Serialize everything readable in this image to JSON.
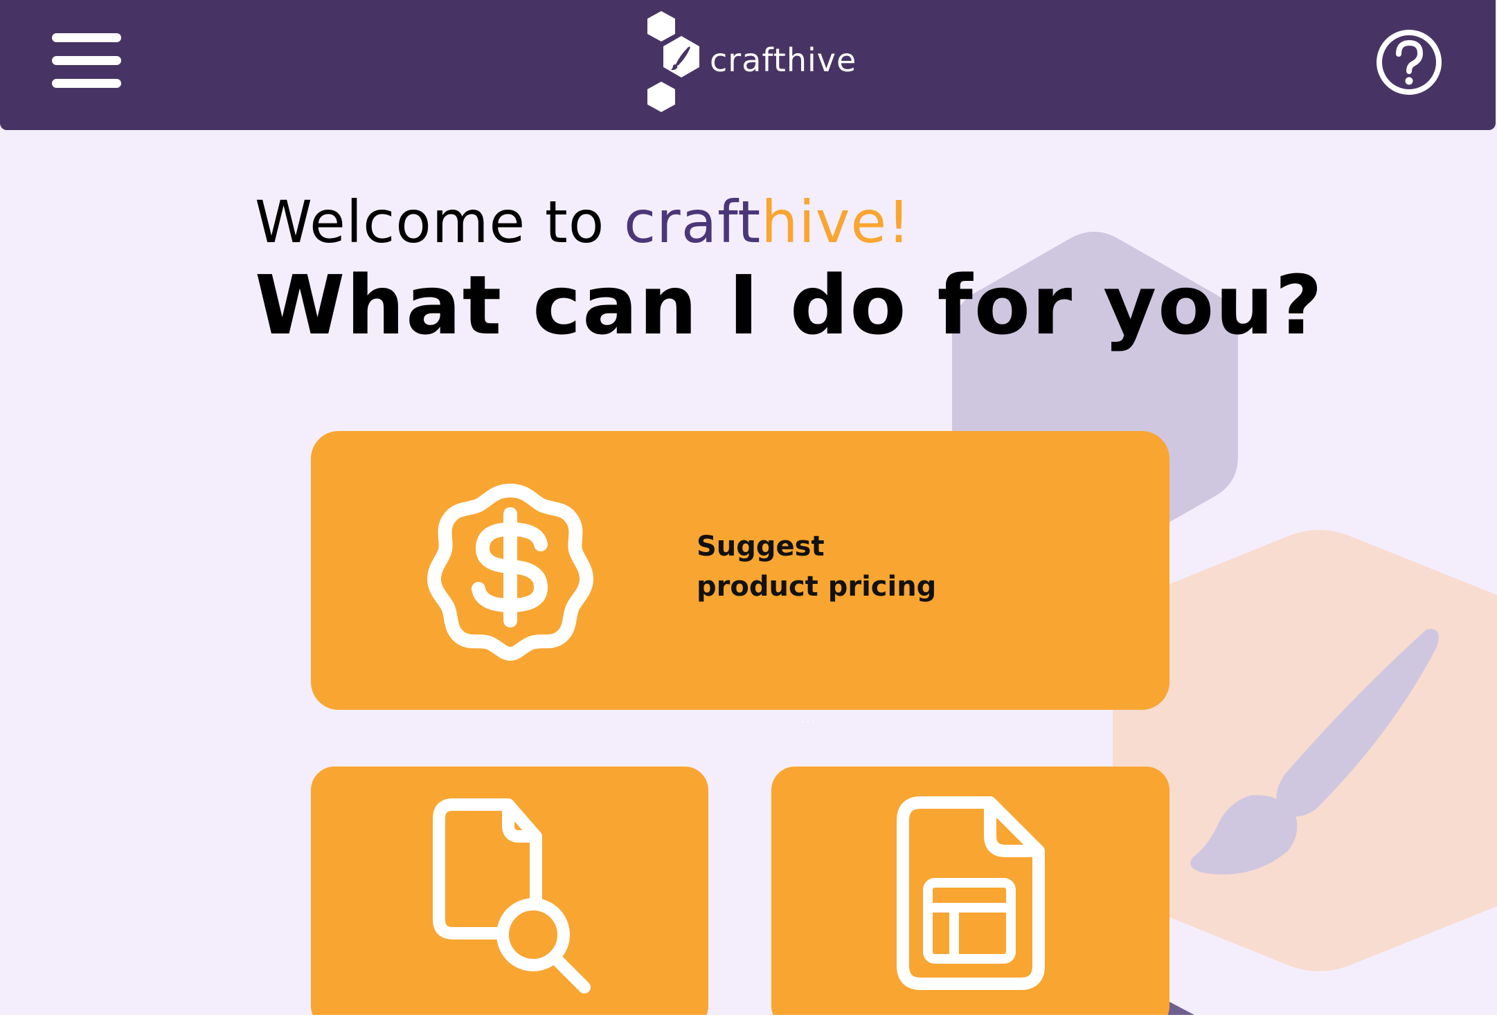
{
  "header": {
    "brand_name": "crafthive",
    "menu_icon": "hamburger-menu-icon",
    "help_icon": "question-circle-icon",
    "logo_icon": "hexagon-brush-logo"
  },
  "main": {
    "welcome_prefix": "Welcome to ",
    "welcome_brand_craft": "craft",
    "welcome_brand_hive": "hive!",
    "question": "What can I do for you?",
    "cards": [
      {
        "icon": "dollar-badge-icon",
        "label_line1": "Suggest",
        "label_line2": "product pricing"
      },
      {
        "icon": "document-search-icon"
      },
      {
        "icon": "spreadsheet-document-icon"
      }
    ]
  },
  "colors": {
    "header_bg": "#483464",
    "page_bg": "#f4eefc",
    "accent_orange": "#f9a531",
    "brand_purple": "#4a3678",
    "deco_lavender": "#cfc7df",
    "deco_peach": "#f8dcd0"
  }
}
